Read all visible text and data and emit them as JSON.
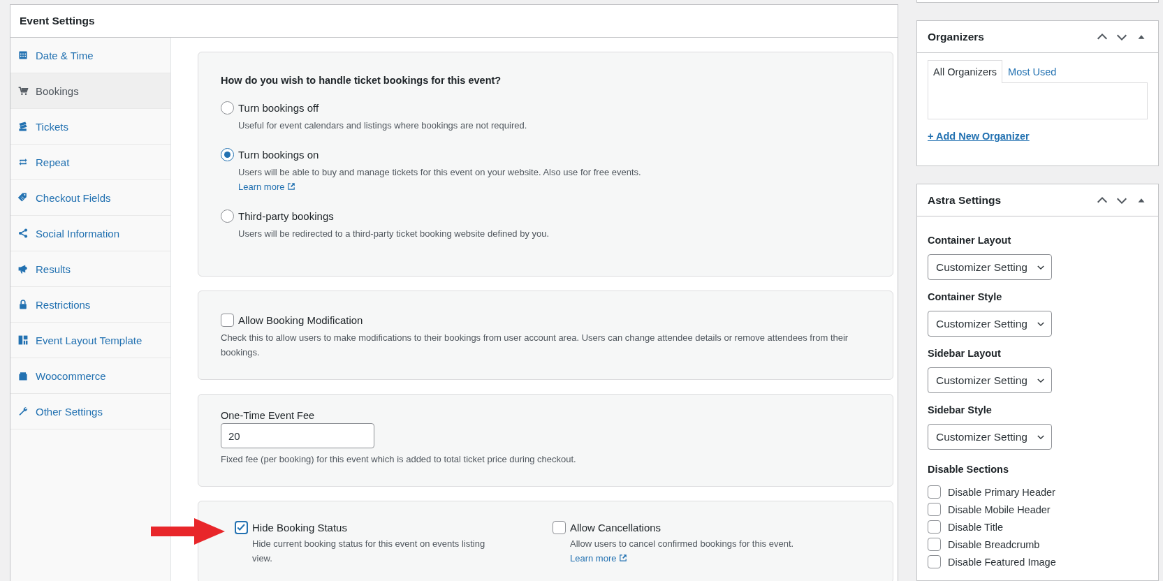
{
  "event_settings": {
    "title": "Event Settings",
    "nav": [
      {
        "label": "Date & Time",
        "selected": false
      },
      {
        "label": "Bookings",
        "selected": true
      },
      {
        "label": "Tickets",
        "selected": false
      },
      {
        "label": "Repeat",
        "selected": false
      },
      {
        "label": "Checkout Fields",
        "selected": false
      },
      {
        "label": "Social Information",
        "selected": false
      },
      {
        "label": "Results",
        "selected": false
      },
      {
        "label": "Restrictions",
        "selected": false
      },
      {
        "label": "Event Layout Template",
        "selected": false
      },
      {
        "label": "Woocommerce",
        "selected": false
      },
      {
        "label": "Other Settings",
        "selected": false
      }
    ],
    "sections": [
      {
        "kind": "radio_group",
        "question": "How do you wish to handle ticket bookings for this event?",
        "options": [
          {
            "label": "Turn bookings off",
            "description": "Useful for event calendars and listings where bookings are not required.",
            "selected": false
          },
          {
            "label": "Turn bookings on",
            "description": "Users will be able to buy and manage tickets for this event on your website. Also use for free events.",
            "link": "Learn more",
            "selected": true
          },
          {
            "label": "Third-party bookings",
            "description": "Users will be redirected to a third-party ticket booking website defined by you.",
            "selected": false
          }
        ]
      },
      {
        "kind": "checkboxes",
        "items": [
          {
            "label": "Allow Booking Modification",
            "description": "Check this to allow users to make modifications to their bookings from user account area. Users can change attendee details or remove attendees from their bookings.",
            "checked": false
          }
        ]
      },
      {
        "kind": "text_input",
        "label": "One-Time Event Fee",
        "value": "20",
        "description": "Fixed fee (per booking) for this event which is added to total ticket price during checkout."
      },
      {
        "kind": "checkboxes",
        "items": [
          {
            "label": "Hide Booking Status",
            "description": "Hide current booking status for this event on events listing view.",
            "checked": true,
            "annotated": true
          },
          {
            "label": "Allow Cancellations",
            "description": "Allow users to cancel confirmed bookings for this event.",
            "link": "Learn more",
            "checked": false
          }
        ]
      }
    ]
  },
  "organizers": {
    "title": "Organizers",
    "tabs": [
      {
        "label": "All Organizers",
        "selected": true
      },
      {
        "label": "Most Used",
        "selected": false
      }
    ],
    "add_link": "+ Add New Organizer"
  },
  "astra_settings": {
    "title": "Astra Settings",
    "selects": [
      {
        "label": "Container Layout",
        "value": "Customizer Setting"
      },
      {
        "label": "Container Style",
        "value": "Customizer Setting"
      },
      {
        "label": "Sidebar Layout",
        "value": "Customizer Setting"
      },
      {
        "label": "Sidebar Style",
        "value": "Customizer Setting"
      }
    ],
    "disable_sections": {
      "title": "Disable Sections",
      "items": [
        {
          "label": "Disable Primary Header",
          "checked": false
        },
        {
          "label": "Disable Mobile Header",
          "checked": false
        },
        {
          "label": "Disable Title",
          "checked": false
        },
        {
          "label": "Disable Breadcrumb",
          "checked": false
        },
        {
          "label": "Disable Featured Image",
          "checked": false
        }
      ]
    }
  }
}
